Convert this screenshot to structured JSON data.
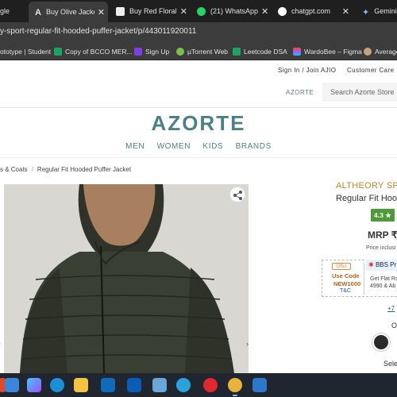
{
  "browser": {
    "tabs": [
      {
        "label": "gle",
        "icon": "google-icon",
        "active": false
      },
      {
        "label": "Buy Olive Jacket",
        "icon": "azorte-icon",
        "active": true
      },
      {
        "label": "Buy Red Floral P",
        "icon": "azorte-icon",
        "active": false
      },
      {
        "label": "(21) WhatsApp",
        "icon": "whatsapp-icon",
        "active": false
      },
      {
        "label": "chatgpt.com",
        "icon": "chatgpt-icon",
        "active": false
      },
      {
        "label": "Gemini",
        "icon": "gemini-icon",
        "active": false
      }
    ],
    "url": "y-sport-regular-fit-hooded-puffer-jacket/p/443011920011",
    "bookmarks": [
      {
        "label": "ototype | Student",
        "icon": "bookmark-icon"
      },
      {
        "label": "Copy of BCCO MER...",
        "icon": "sheets-icon"
      },
      {
        "label": "Sign Up",
        "icon": "signup-icon"
      },
      {
        "label": "µTorrent Web",
        "icon": "utorrent-icon"
      },
      {
        "label": "Leetcode DSA",
        "icon": "sheets-icon"
      },
      {
        "label": "WardoBee – Figma",
        "icon": "figma-icon"
      },
      {
        "label": "Average",
        "icon": "avatar-icon"
      }
    ]
  },
  "header": {
    "signin": "Sign In / Join AJIO",
    "customer_care": "Customer Care",
    "azorte_link": "AZORTE",
    "search_placeholder": "Search Azorte Store",
    "logo": "AZORTE",
    "nav": [
      "MEN",
      "WOMEN",
      "KIDS",
      "BRANDS"
    ]
  },
  "breadcrumb": {
    "items": [
      "s & Coats",
      "Regular Fit Hooded Puffer Jacket"
    ]
  },
  "product": {
    "brand": "ALTHEORY SPO",
    "name": "Regular Fit Hood",
    "rating": "4.3 ★",
    "mrp": "MRP ₹",
    "price_note": "Price inclusi",
    "offer": {
      "tag": "Offer",
      "use_code": "Use Code",
      "code": "NEW1000",
      "tnc": "T&C",
      "bank": "BBS Pr",
      "flat_line1": "Get Flat Rs",
      "flat_line2": "4990 & Ab"
    },
    "more_offers": "+7",
    "color_label": "O",
    "select_label": "Sele"
  },
  "colors": {
    "accent": "#4d7f86",
    "brand_gold": "#b58a2b",
    "rating_green": "#4c9b38"
  }
}
